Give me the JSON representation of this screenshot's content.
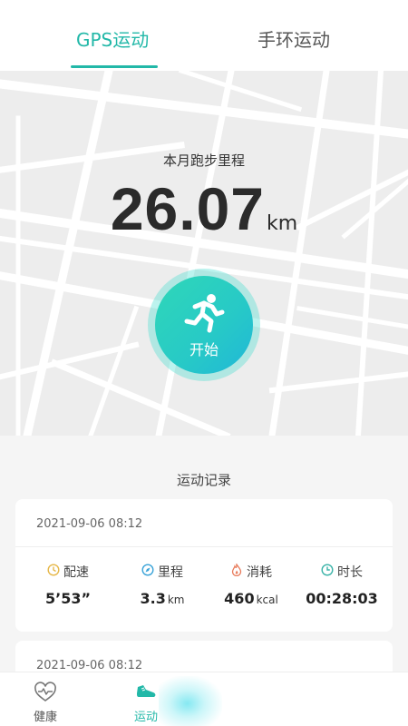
{
  "tabs": [
    {
      "label": "GPS运动",
      "active": true
    },
    {
      "label": "手环运动",
      "active": false
    }
  ],
  "hero": {
    "month_label": "本月跑步里程",
    "distance": "26.07",
    "unit": "km",
    "start_label": "开始"
  },
  "records": {
    "title": "运动记录",
    "items": [
      {
        "datetime": "2021-09-06  08:12",
        "pace_label": "配速",
        "pace_value": "5’53”",
        "distance_label": "里程",
        "distance_value": "3.3",
        "distance_unit": "km",
        "calorie_label": "消耗",
        "calorie_value": "460",
        "calorie_unit": "kcal",
        "duration_label": "时长",
        "duration_value": "00:28:03"
      },
      {
        "datetime": "2021-09-06  08:12"
      }
    ]
  },
  "bottom_nav": [
    {
      "label": "健康",
      "icon": "heart-pulse-icon"
    },
    {
      "label": "运动",
      "icon": "shoe-icon",
      "active": true
    }
  ],
  "colors": {
    "accent": "#22b8a8",
    "button_start": "#2fd7b8",
    "button_end": "#20b7d8",
    "pace_icon": "#e6b84a",
    "distance_icon": "#3aa3d8",
    "calorie_icon": "#e87a5a",
    "duration_icon": "#3ab3a8"
  }
}
